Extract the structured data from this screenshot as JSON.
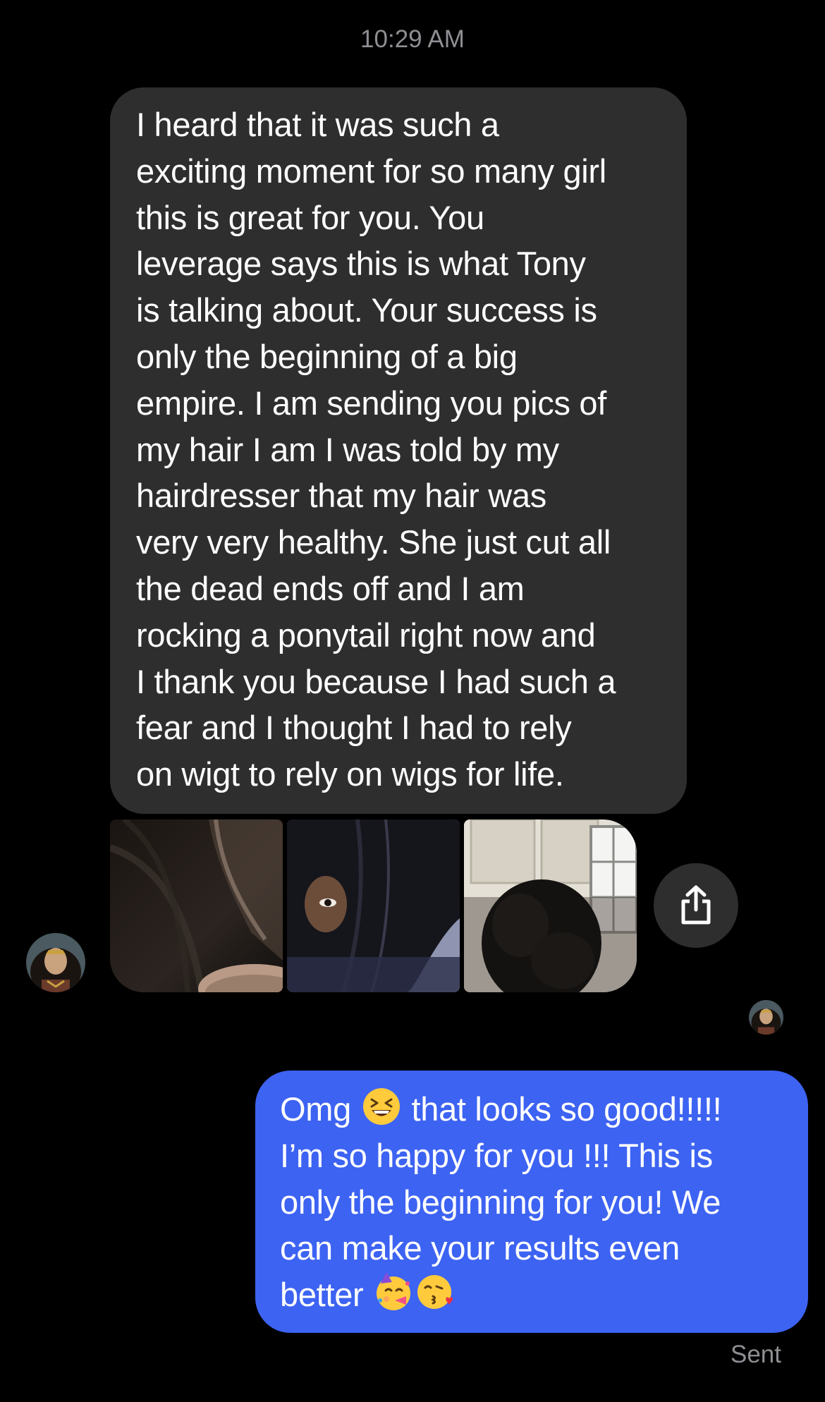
{
  "timestamp": "10:29 AM",
  "incoming_message": {
    "lines": [
      "I heard that it was such a",
      "exciting moment for so many girl",
      "this is great for you. You",
      "leverage says this is what Tony",
      "is talking about. Your success is",
      "only the beginning of a big",
      "empire. I am sending you pics of",
      "my hair I am I was told by my",
      "hairdresser that my hair was",
      "very very healthy. She just cut all",
      "the dead ends off and I am",
      "rocking a ponytail right now and",
      "I thank you because I had such a",
      "fear and I thought I had to rely",
      "on wigt to rely on wigs for life."
    ]
  },
  "photos": [
    "hair-part-photo",
    "selfie-straight-hair-photo",
    "curly-hair-back-photo"
  ],
  "outgoing_message": {
    "line1": [
      "Omg",
      "that looks so good!!!!!"
    ],
    "line2": "I’m so happy for you !!! This is",
    "line3": "only the beginning for you! We",
    "line4": "can make your results even",
    "line5": "better",
    "emojis": [
      "grinning-squinting-face",
      "partying-face",
      "face-blowing-a-kiss"
    ]
  },
  "status": "Sent",
  "colors": {
    "background": "#000000",
    "incoming_bubble": "#2e2e2e",
    "outgoing_bubble": "#3d63f2",
    "meta_text": "#8e8e93"
  },
  "icons": [
    "share-icon"
  ]
}
